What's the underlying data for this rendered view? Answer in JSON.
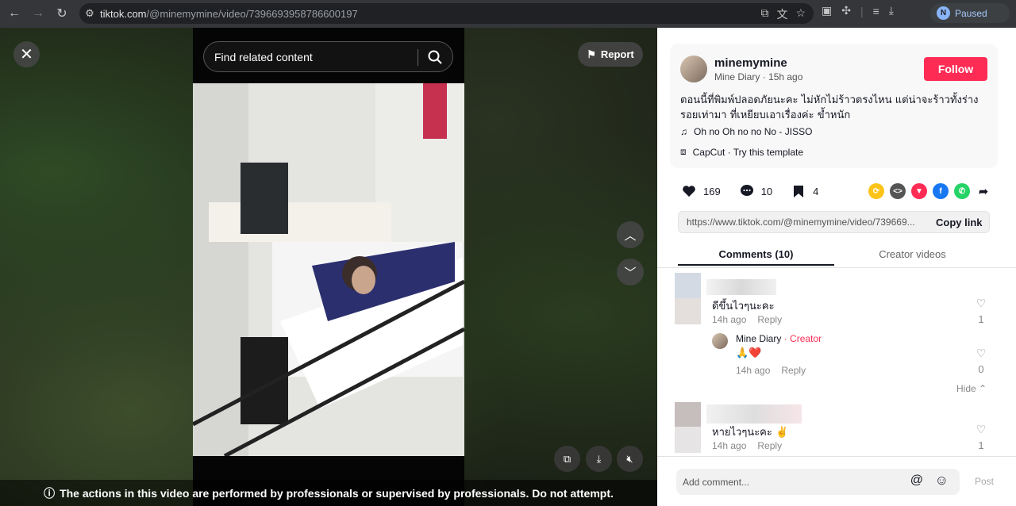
{
  "browser": {
    "url_host": "tiktok.com",
    "url_path": "/@minemymine/video/7396693958786600197",
    "profile_initial": "N",
    "profile_status": "Paused"
  },
  "video": {
    "search_placeholder": "Find related content",
    "report_label": "Report",
    "warning_text": "The actions in this video are performed by professionals or supervised by professionals. Do not attempt."
  },
  "post": {
    "username": "minemymine",
    "display_name": "Mine Diary",
    "time_ago": "15h ago",
    "follow_label": "Follow",
    "caption": "ตอนนี้ที่พิมพ์ปลอดภัยนะคะ ไม่หักไม่ร้าวตรงไหน แต่น่าจะร้าวทั้งร่าง รอยเท่ามา ที่เหยียบเอาเรื่องค่ะ ข้ำหนัก",
    "music": "Oh no Oh no no No - JISSO",
    "template": "CapCut · Try this template",
    "likes": "169",
    "comments": "10",
    "saves": "4",
    "link": "https://www.tiktok.com/@minemymine/video/739669...",
    "copy_label": "Copy link"
  },
  "tabs": {
    "comments_label": "Comments (10)",
    "creator_label": "Creator videos"
  },
  "comments": [
    {
      "text": "ดีขึ้นไวๆนะคะ",
      "time": "14h ago",
      "reply": "Reply",
      "likes": "1"
    },
    {
      "author": "Mine Diary",
      "tag": "· Creator",
      "text": "🙏❤️",
      "time": "14h ago",
      "reply": "Reply",
      "likes": "0",
      "hide": "Hide ⌃"
    },
    {
      "text": "หายไวๆนะคะ ✌️",
      "time": "14h ago",
      "reply": "Reply",
      "likes": "1"
    }
  ],
  "comment_bar": {
    "placeholder": "Add comment...",
    "post_label": "Post"
  },
  "colors": {
    "accent": "#fe2c55",
    "panel_bg": "#ffffff"
  }
}
